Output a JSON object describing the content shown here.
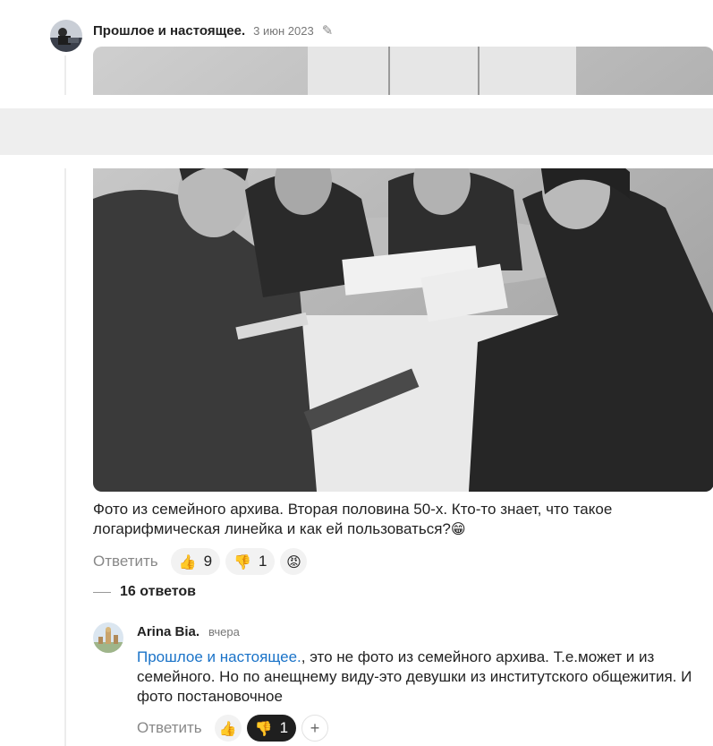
{
  "post": {
    "author": "Прошлое и настоящее.",
    "date": "3 июн 2023",
    "edit_icon": "pencil-icon",
    "text": "Фото из семейного архива. Вторая половина 50-х. Кто-то знает, что такое логарифмическая линейка и как ей пользоваться?",
    "text_emoji": "😁",
    "reply_label": "Ответить",
    "reactions": [
      {
        "icon": "thumbs-up-icon",
        "glyph": "👍",
        "count": "9"
      },
      {
        "icon": "thumbs-down-icon",
        "glyph": "👎",
        "count": "1"
      },
      {
        "icon": "angry-face-icon",
        "glyph": "😡",
        "count": ""
      }
    ]
  },
  "replies_summary": "16 ответов",
  "comment": {
    "author": "Arina Bia.",
    "time": "вчера",
    "mention": "Прошлое и настоящее.",
    "text": ", это не фото из семейного архива. Т.е.может и из семейного. Но по анещнему виду-это девушки из институтского общежития. И фото постановочное",
    "reply_label": "Ответить",
    "reactions": [
      {
        "icon": "thumbs-up-icon",
        "glyph": "👍",
        "count": ""
      },
      {
        "icon": "thumbs-down-icon",
        "glyph": "👎",
        "count": "1"
      },
      {
        "icon": "add-reaction-icon",
        "glyph": "+",
        "count": ""
      }
    ]
  },
  "colors": {
    "link": "#1a73c8",
    "pill": "#f2f2f2",
    "pill_active": "#1f1f1f"
  }
}
